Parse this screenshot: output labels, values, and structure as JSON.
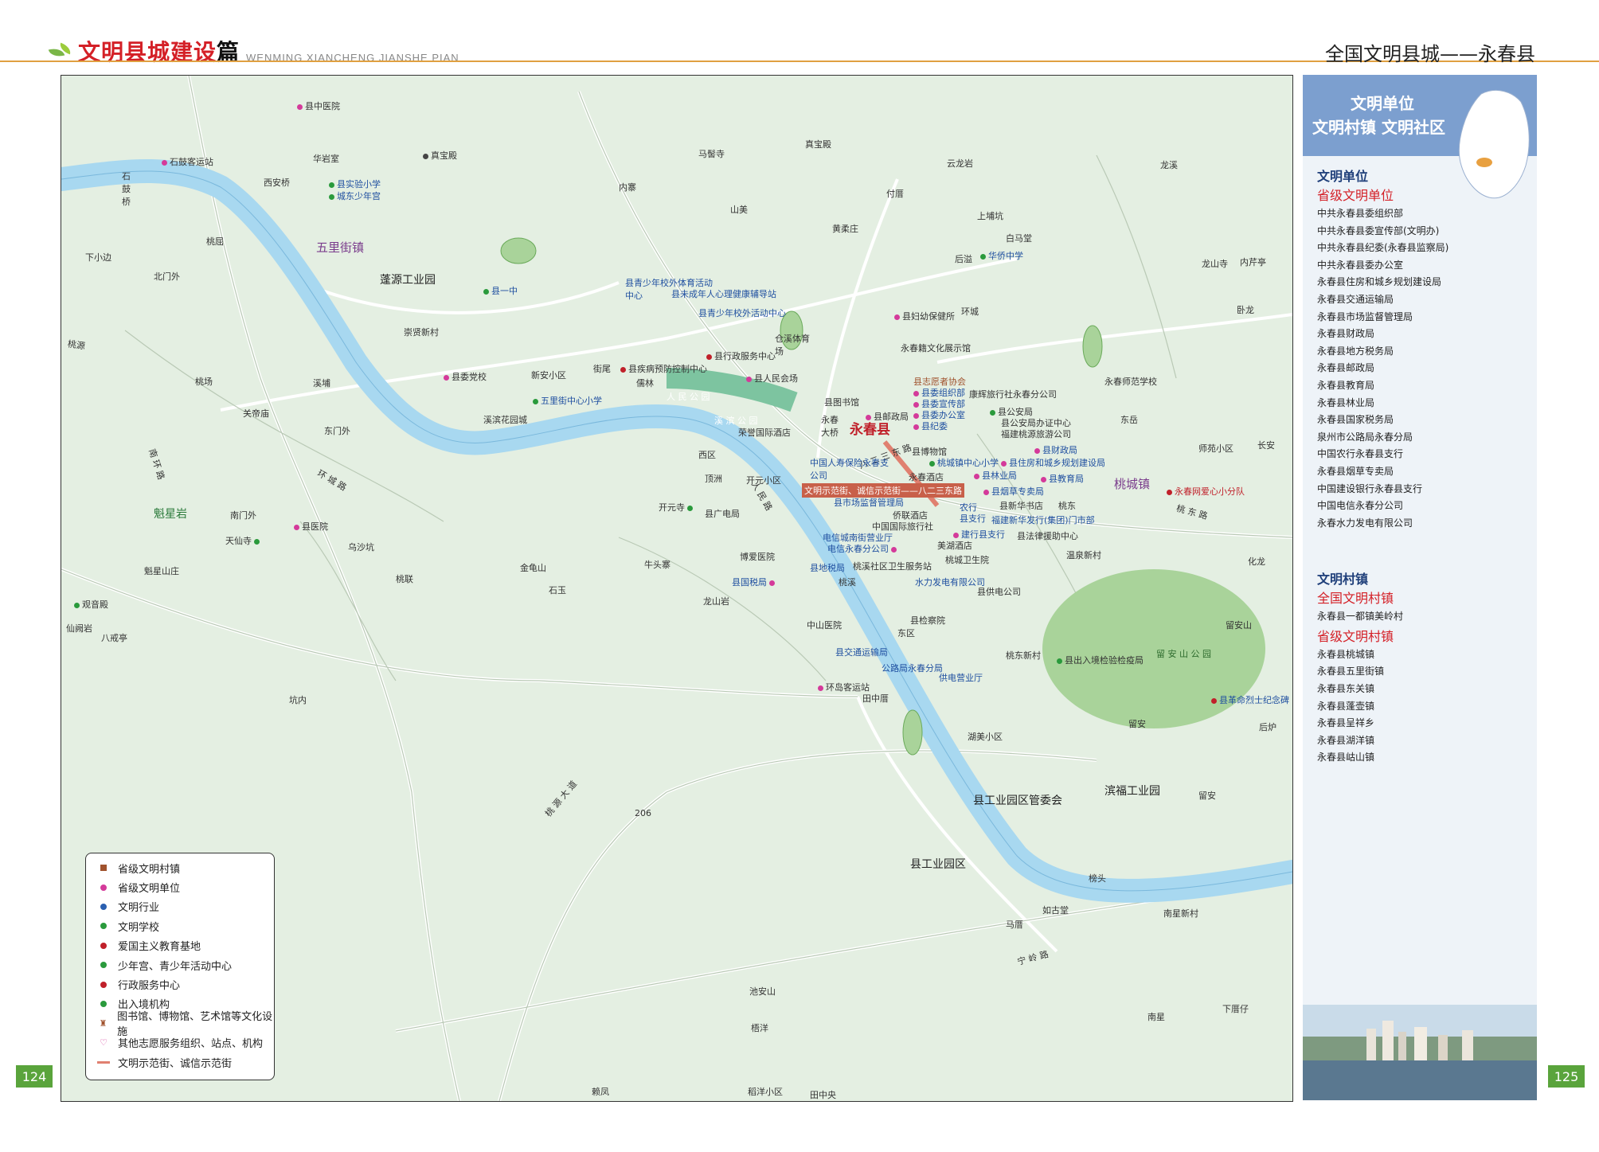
{
  "header": {
    "title_main": "文明县城建设",
    "title_pian": "篇",
    "pinyin": "WENMING XIANCHENG JIANSHE PIAN",
    "right_title": "全国文明县城——永春县"
  },
  "page_left": "124",
  "page_right": "125",
  "colors": {
    "water": "#a8d8f0",
    "land": "#e4efe2",
    "park": "#a9d39a",
    "accent": "#d42027",
    "panel": "#7c9fcf"
  },
  "map": {
    "county": "永春县",
    "towns": [
      "五里街镇",
      "桃城镇"
    ],
    "areas": [
      "蓬源工业园",
      "滨福工业园",
      "县工业园区管委会",
      "县工业园区"
    ],
    "parks": [
      "留 安 山 公 园",
      "人 民 公 园",
      "溪 滨 公 园"
    ],
    "labels": {
      "l1": "县中医院",
      "l2": "石鼓客运站",
      "l3": "西安桥",
      "l4": "华岩室",
      "l5": "县实验小学",
      "l6": "城东少年宫",
      "l7": "真宝殿",
      "l8": "马髻寺",
      "l9": "真宝殿",
      "l10": "云龙岩",
      "l11": "龙溪",
      "l12": "付厝",
      "l13": "内寨",
      "l14": "山美",
      "l15": "黄柔庄",
      "l16": "上埔坑",
      "l17": "白马堂",
      "l18": "华侨中学",
      "l19": "后溢",
      "l20": "龙山寺",
      "l21": "内芹亭",
      "l22": "卧龙",
      "l23": "下小边",
      "l24": "桃屈",
      "l25": "北门外",
      "l26": "崇贤新村",
      "l27": "县一中",
      "l28": "县青少年校外体育活动中心",
      "l29": "县未成年人心理健康辅导站",
      "l30": "县青少年校外活动中心",
      "l31": "仓溪体育场",
      "l32": "县妇幼保健所",
      "l33": "环城",
      "l34": "永春籍文化展示馆",
      "l35": "县行政服务中心",
      "l36": "县疾病预防控制中心",
      "l37": "县人民会场",
      "l38": "县委党校",
      "l39": "新安小区",
      "l40": "街尾",
      "l41": "儒林",
      "l42": "五里街中心小学",
      "l43": "溪滨花园城",
      "l44": "桃场",
      "l45": "溪埔",
      "l46": "关帝庙",
      "l47": "东门外",
      "l48": "县图书馆",
      "l49": "县邮政局",
      "l50": "县志愿者协会",
      "l51": "县委组织部",
      "l52": "县委宣传部",
      "l53": "县委办公室",
      "l54": "县纪委",
      "l55": "康辉旅行社永春分公司",
      "l56": "县公安局",
      "l57": "县公安局办证中心",
      "l58": "福建桃源旅游公司",
      "l59": "永春师范学校",
      "l60": "东岳",
      "l61": "师苑小区",
      "l62": "长安",
      "l63": "荣誉国际酒店",
      "l64": "西区",
      "l65": "永春大桥",
      "l66": "县博物馆",
      "l67": "桃城镇中心小学",
      "l68": "县财政局",
      "l69": "县住房和城乡规划建设局",
      "l70": "中国人寿保险永春支公司",
      "l71": "顶洲",
      "l72": "开元小区",
      "l73": "县林业局",
      "l74": "县教育局",
      "l75": "永春酒店",
      "l76": "文明示范街、诚信示范街——八二三东路",
      "l77": "县烟草专卖局",
      "l78": "永春网爱心小分队",
      "l79": "魁星岩",
      "l80": "开元寺",
      "l81": "县市场监督管理局",
      "l82": "县广电局",
      "l83": "侨联酒店",
      "l84": "中国国际旅行社",
      "l85": "农行",
      "l86": "县支行",
      "l87": "县新华书店",
      "l88": "福建新华发行(集团)门市部",
      "l89": "桃东",
      "l90": "县医院",
      "l91": "南门外",
      "l92": "天仙寺",
      "l93": "乌沙坑",
      "l94": "电信城南街营业厅",
      "l95": "电信永春分公司",
      "l96": "建行县支行",
      "l97": "美湖酒店",
      "l98": "县法律援助中心",
      "l99": "桃溪社区卫生服务站",
      "l100": "桃城卫生院",
      "l101": "温泉新村",
      "l102": "魁星山庄",
      "l103": "金龟山",
      "l104": "牛头寨",
      "l105": "博爱医院",
      "l106": "县地税局",
      "l107": "县国税局",
      "l108": "水力发电有限公司",
      "l109": "县供电公司",
      "l110": "桃联",
      "l111": "石玉",
      "l112": "桃溪",
      "l113": "龙山岩",
      "l114": "化龙",
      "l115": "观音殿",
      "l116": "仙阙岩",
      "l117": "八戒亭",
      "l118": "中山医院",
      "l119": "县检察院",
      "l120": "东区",
      "l121": "县交通运输局",
      "l122": "公路局永春分局",
      "l123": "供电营业厅",
      "l124": "桃东新村",
      "l125": "县出入境检验检疫局",
      "l126": "留安山",
      "l127": "县革命烈士纪念碑",
      "l128": "坑内",
      "l129": "环岛客运站",
      "l130": "田中厝",
      "l131": "留安",
      "l132": "后炉",
      "l133": "湖美小区",
      "l134": "留安",
      "l135": "榜头",
      "l136": "马厝",
      "l137": "南星新村",
      "l138": "如古堂",
      "l139": "池安山",
      "l140": "梧洋",
      "l141": "南星",
      "l142": "下厝仔",
      "l143": "赖凤",
      "l144": "稻洋小区",
      "l145": "田中央",
      "l146": "桃源",
      "l147": "石鼓桥"
    },
    "roads": [
      "南 环 路",
      "环 城 路",
      "八 二 三 东 路",
      "桃 源 大 道",
      "宁 岭 路",
      "206",
      "人 民 路",
      "桃 东 路"
    ]
  },
  "legend": {
    "items": [
      "省级文明村镇",
      "省级文明单位",
      "文明行业",
      "文明学校",
      "爱国主义教育基地",
      "少年宫、青少年活动中心",
      "行政服务中心",
      "出入境机构",
      "图书馆、博物馆、艺术馆等文化设施",
      "其他志愿服务组织、站点、机构",
      "文明示范街、诚信示范街"
    ],
    "colors": [
      "#a0522d",
      "#d43a9a",
      "#2a5fb0",
      "#2a9a3c",
      "#c0202a",
      "#2a9a3c",
      "#c0202a",
      "#2a9a3c",
      "#a0522d",
      "#d43a9a",
      "#e08070"
    ]
  },
  "panel": {
    "title1": "文明单位",
    "title2": "文明村镇  文明社区",
    "units_title": "文明单位",
    "units_sub": "省级文明单位",
    "units": [
      "中共永春县委组织部",
      "中共永春县委宣传部(文明办)",
      "中共永春县纪委(永春县监察局)",
      "中共永春县委办公室",
      "永春县住房和城乡规划建设局",
      "永春县交通运输局",
      "永春县市场监督管理局",
      "永春县财政局",
      "永春县地方税务局",
      "永春县邮政局",
      "永春县教育局",
      "永春县林业局",
      "永春县国家税务局",
      "泉州市公路局永春分局",
      "中国农行永春县支行",
      "永春县烟草专卖局",
      "中国建设银行永春县支行",
      "中国电信永春分公司",
      "永春水力发电有限公司"
    ],
    "villages_title": "文明村镇",
    "villages_national_sub": "全国文明村镇",
    "villages_national": [
      "永春县一都镇美岭村"
    ],
    "villages_province_sub": "省级文明村镇",
    "villages_province": [
      "永春县桃城镇",
      "永春县五里街镇",
      "永春县东关镇",
      "永春县蓬壶镇",
      "永春县呈祥乡",
      "永春县湖洋镇",
      "永春县岵山镇"
    ]
  }
}
